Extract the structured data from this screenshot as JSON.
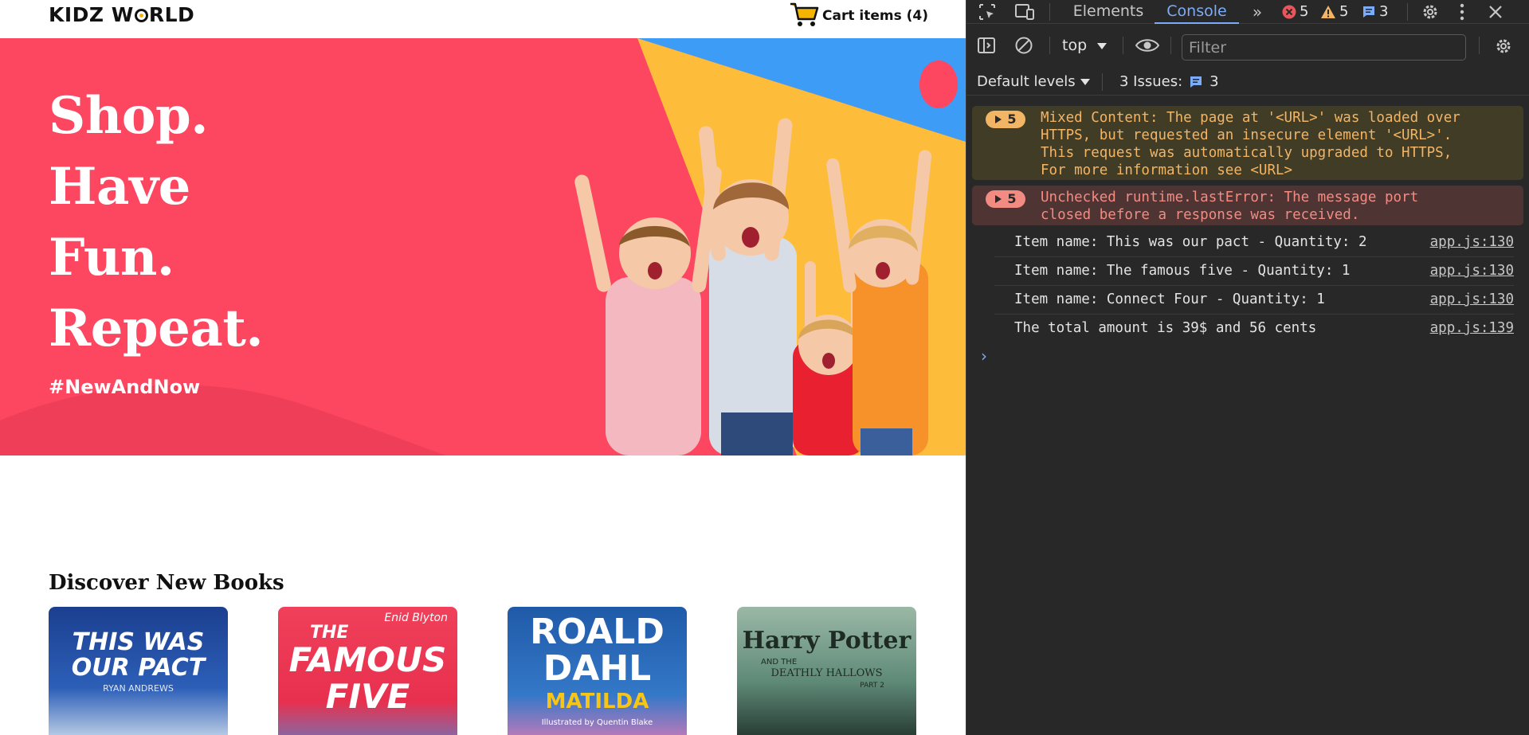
{
  "site": {
    "logo": "KIDZ WORLD",
    "logo_parts": [
      "KIDZ W",
      "RLD"
    ],
    "cart_label": "Cart items (4)",
    "hero": {
      "lines": [
        "Shop.",
        "Have",
        "Fun.",
        "Repeat."
      ],
      "tag": "#NewAndNow"
    },
    "section_title": "Discover New Books",
    "books": [
      {
        "title_a": "THIS WAS",
        "title_b": "OUR PACT",
        "author": "RYAN ANDREWS"
      },
      {
        "title_a": "THE",
        "title_b": "FAMOUS",
        "title_c": "FIVE",
        "author": "Enid Blyton"
      },
      {
        "title_a": "ROALD",
        "title_b": "DAHL",
        "title_c": "MATILDA",
        "author": "Illustrated by Quentin Blake"
      },
      {
        "title_a": "Harry Potter",
        "title_b": "AND THE",
        "title_c": "DEATHLY HALLOWS",
        "author": "PART 2"
      }
    ],
    "colors": {
      "hero_bg": "#fd4660",
      "hero_yellow": "#fdbd3a",
      "hero_blue": "#3d9cf5"
    }
  },
  "devtools": {
    "tabs": [
      "Elements",
      "Console"
    ],
    "active_tab": "Console",
    "error_count": "5",
    "warning_count": "5",
    "info_count": "3",
    "context": "top",
    "filter_placeholder": "Filter",
    "levels_label": "Default levels",
    "issues_label": "3 Issues:",
    "issues_count": "3",
    "messages": [
      {
        "type": "warning",
        "count": "5",
        "text": "Mixed Content: The page at '<URL>' was loaded over\nHTTPS, but requested an insecure element '<URL>'.\nThis request was automatically upgraded to HTTPS,\nFor more information see <URL>"
      },
      {
        "type": "error",
        "count": "5",
        "text": "Unchecked runtime.lastError: The message port\nclosed before a response was received."
      }
    ],
    "logs": [
      {
        "text": "Item name: This was our pact - Quantity: 2",
        "source": "app.js:130"
      },
      {
        "text": "Item name: The famous five - Quantity: 1",
        "source": "app.js:130"
      },
      {
        "text": "Item name: Connect Four - Quantity: 1",
        "source": "app.js:130"
      },
      {
        "text": "The total amount is 39$ and 56 cents",
        "source": "app.js:139"
      }
    ],
    "colors": {
      "panel_bg": "#282828",
      "accent": "#7cacf8",
      "warning": "#f2b566",
      "error": "#f28b82"
    }
  }
}
